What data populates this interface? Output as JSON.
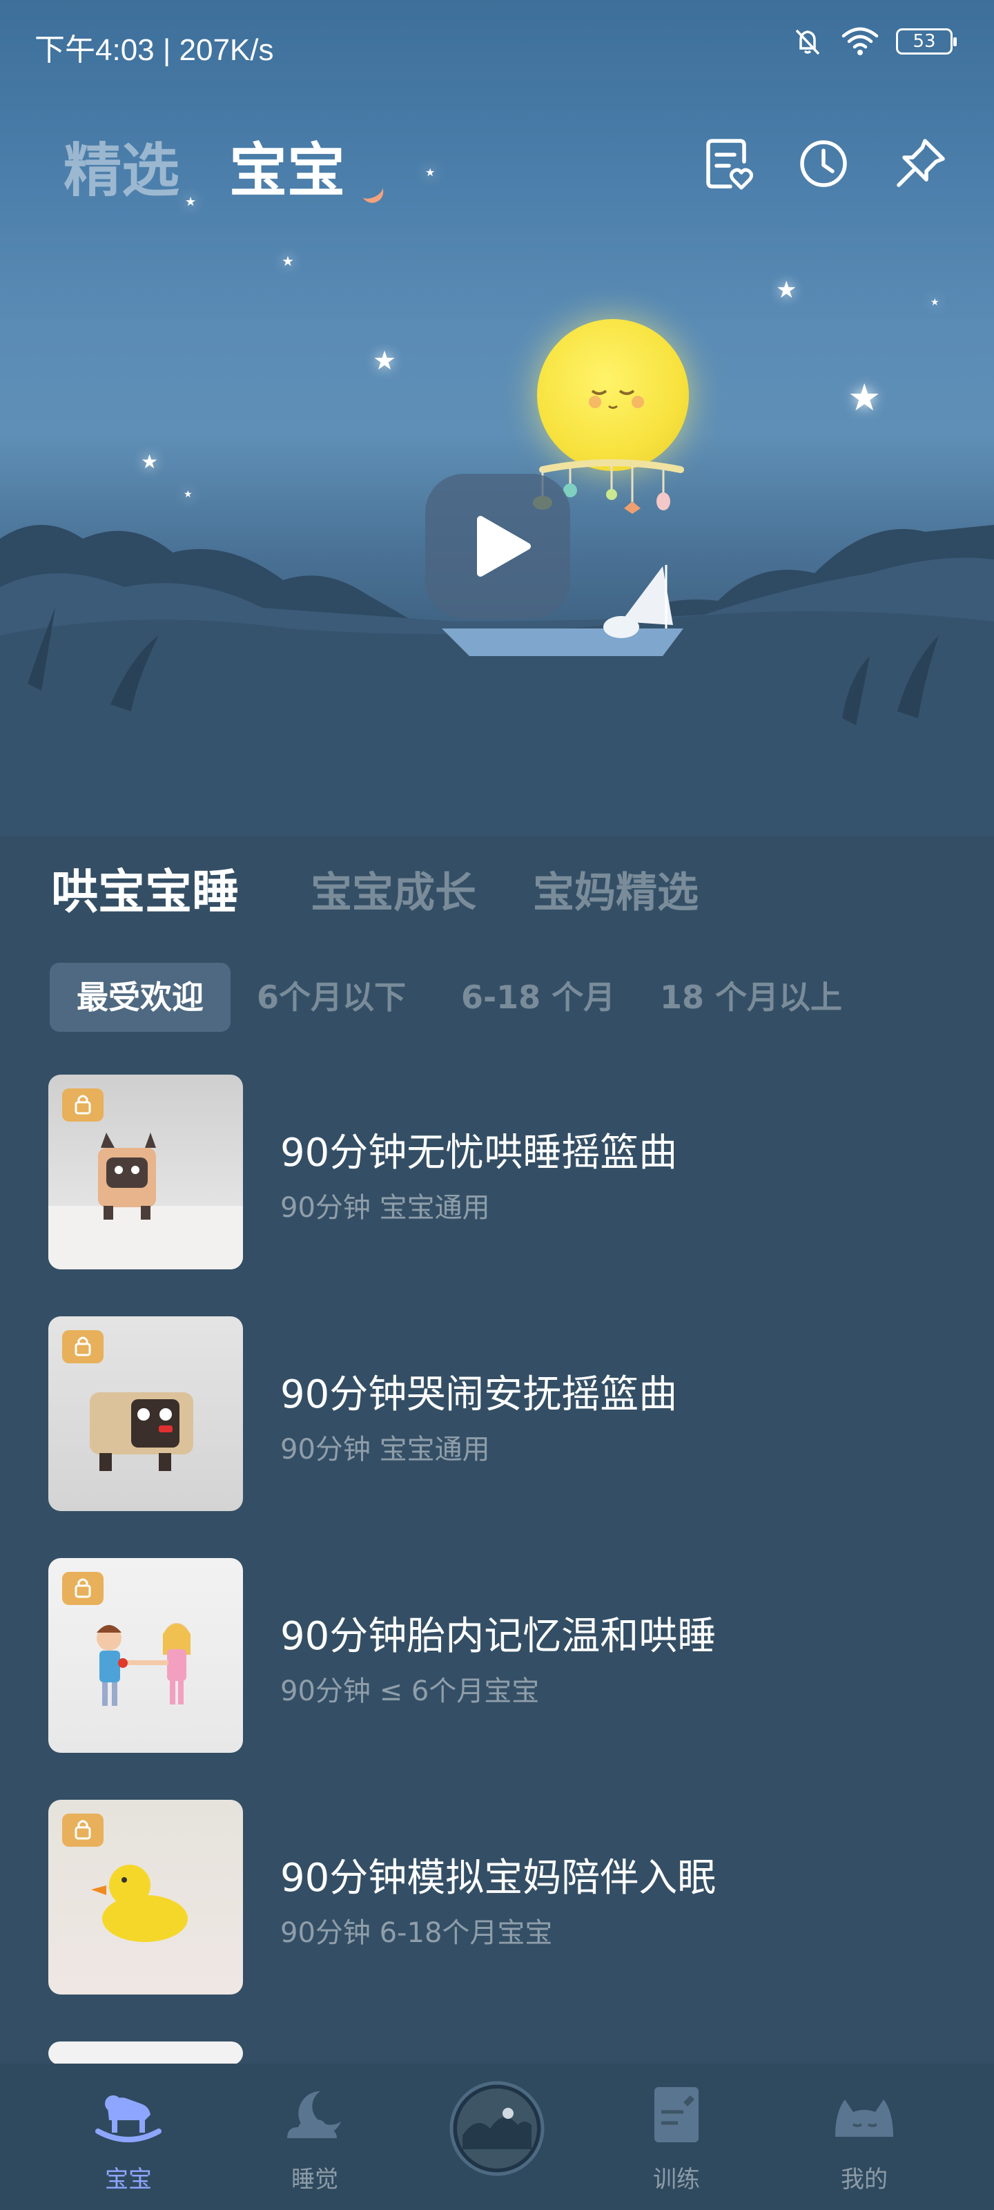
{
  "status_bar": {
    "time": "下午4:03 | 207K/s",
    "battery": "53"
  },
  "top_nav": {
    "tabs": [
      "精选",
      "宝宝"
    ],
    "active_tab": "宝宝"
  },
  "section_tabs": {
    "tabs": [
      "哄宝宝睡",
      "宝宝成长",
      "宝妈精选"
    ],
    "active": "哄宝宝睡"
  },
  "filters": {
    "chips": [
      "最受欢迎",
      "6个月以下",
      "6-18 个月",
      "18 个月以上"
    ],
    "active": "最受欢迎"
  },
  "items": [
    {
      "title": "90分钟无忧哄睡摇篮曲",
      "subtitle": "90分钟 宝宝通用"
    },
    {
      "title": "90分钟哭闹安抚摇篮曲",
      "subtitle": "90分钟 宝宝通用"
    },
    {
      "title": "90分钟胎内记忆温和哄睡",
      "subtitle": "90分钟 ≤ 6个月宝宝"
    },
    {
      "title": "90分钟模拟宝妈陪伴入眠",
      "subtitle": "90分钟 6-18个月宝宝"
    }
  ],
  "bottom_nav": {
    "items": [
      "宝宝",
      "睡觉",
      "训练",
      "我的"
    ],
    "active": "宝宝"
  },
  "colors": {
    "background": "#344f65",
    "accent": "#8ea6ff",
    "lock": "#e8b05a",
    "moon": "#f7e23e"
  }
}
